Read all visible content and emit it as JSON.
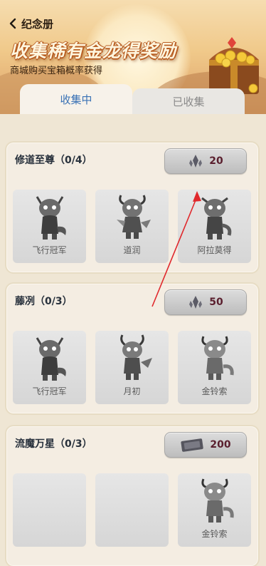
{
  "header": {
    "back_label": "纪念册",
    "banner_title": "收集稀有金龙得奖励",
    "banner_subtitle": "商城购买宝箱概率获得"
  },
  "tabs": [
    {
      "label": "收集中",
      "active": true
    },
    {
      "label": "已收集",
      "active": false
    }
  ],
  "colors": {
    "active_tab_text": "#3a72b5",
    "cost_text": "#5a1f2e",
    "title_text": "#28313c",
    "annotation_arrow": "#e0282c"
  },
  "collections": [
    {
      "title": "修道至尊（0/4）",
      "cost_icon": "crystal-icon",
      "cost": "20",
      "slots": [
        {
          "name": "飞行冠军",
          "icon": "dragon-icon"
        },
        {
          "name": "道润",
          "icon": "dragon-icon"
        },
        {
          "name": "阿拉莫得",
          "icon": "dragon-icon"
        }
      ]
    },
    {
      "title": "藤冽（0/3）",
      "cost_icon": "crystal-icon",
      "cost": "50",
      "slots": [
        {
          "name": "飞行冠军",
          "icon": "dragon-icon"
        },
        {
          "name": "月初",
          "icon": "dragon-icon"
        },
        {
          "name": "金铃索",
          "icon": "dragon-icon"
        }
      ]
    },
    {
      "title": "流魔万星（0/3）",
      "cost_icon": "ticket-icon",
      "cost": "200",
      "slots": [
        {
          "name": "",
          "icon": "empty"
        },
        {
          "name": "",
          "icon": "empty"
        },
        {
          "name": "金铃索",
          "icon": "dragon-icon"
        }
      ]
    }
  ]
}
